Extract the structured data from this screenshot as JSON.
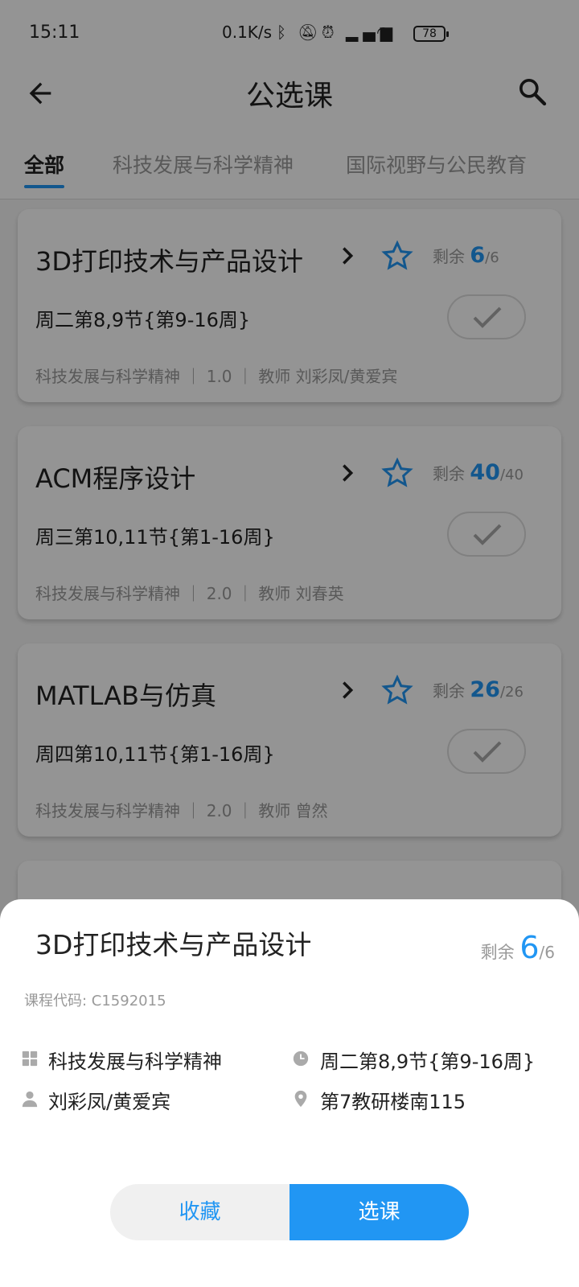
{
  "status": {
    "time": "15:11",
    "net_speed": "0.1K/s",
    "battery": "78"
  },
  "header": {
    "title": "公选课"
  },
  "tabs": [
    {
      "label": "全部",
      "active": true
    },
    {
      "label": "科技发展与科学精神",
      "active": false
    },
    {
      "label": "国际视野与公民教育",
      "active": false
    }
  ],
  "courses": [
    {
      "title": "3D打印技术与产品设计",
      "remain_label": "剩余",
      "remain": "6",
      "total": "/6",
      "schedule": "周二第8,9节{第9-16周}",
      "meta": "科技发展与科学精神 ｜ 1.0 ｜ 教师 刘彩凤/黄爱宾"
    },
    {
      "title": "ACM程序设计",
      "remain_label": "剩余",
      "remain": "40",
      "total": "/40",
      "schedule": "周三第10,11节{第1-16周}",
      "meta": "科技发展与科学精神 ｜ 2.0 ｜ 教师 刘春英"
    },
    {
      "title": "MATLAB与仿真",
      "remain_label": "剩余",
      "remain": "26",
      "total": "/26",
      "schedule": "周四第10,11节{第1-16周}",
      "meta": "科技发展与科学精神 ｜ 2.0 ｜ 教师 曾然"
    }
  ],
  "sheet": {
    "title": "3D打印技术与产品设计",
    "remain_label": "剩余",
    "remain": "6",
    "total": "/6",
    "course_code": "课程代码: C1592015",
    "category": "科技发展与科学精神",
    "schedule": "周二第8,9节{第9-16周}",
    "teacher": "刘彩凤/黄爱宾",
    "location": "第7教研楼南115",
    "fav_label": "收藏",
    "select_label": "选课"
  },
  "colors": {
    "accent": "#2196f3",
    "overlay": "rgba(0,0,0,0.42)"
  }
}
